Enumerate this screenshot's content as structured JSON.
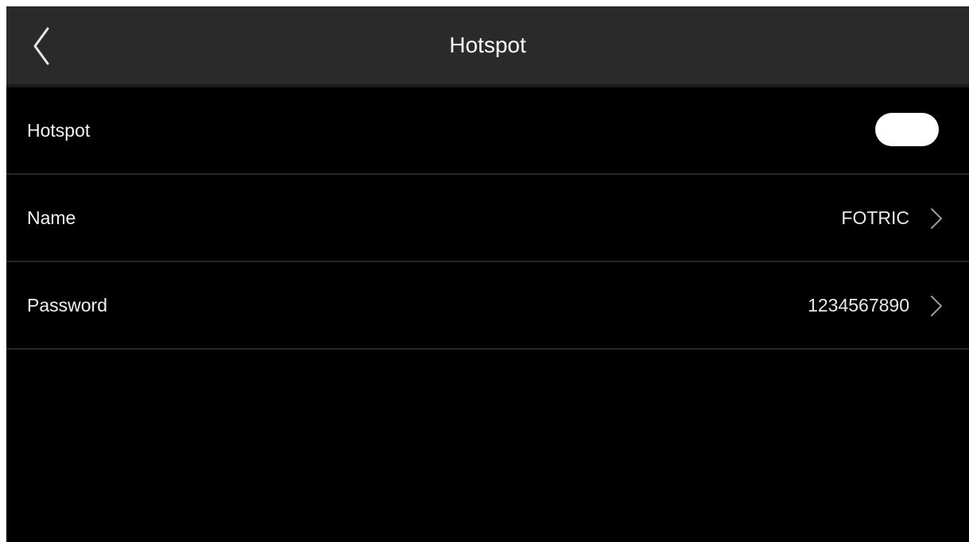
{
  "header": {
    "title": "Hotspot",
    "back_icon": "chevron-left-icon"
  },
  "settings": {
    "hotspot": {
      "label": "Hotspot",
      "toggle_state": "on"
    },
    "name": {
      "label": "Name",
      "value": "FOTRIC",
      "icon": "chevron-right-icon"
    },
    "password": {
      "label": "Password",
      "value": "1234567890",
      "icon": "chevron-right-icon"
    }
  },
  "colors": {
    "header_bg": "#2a2a2a",
    "screen_bg": "#000000",
    "text": "#ffffff",
    "toggle": "#ffffff"
  }
}
